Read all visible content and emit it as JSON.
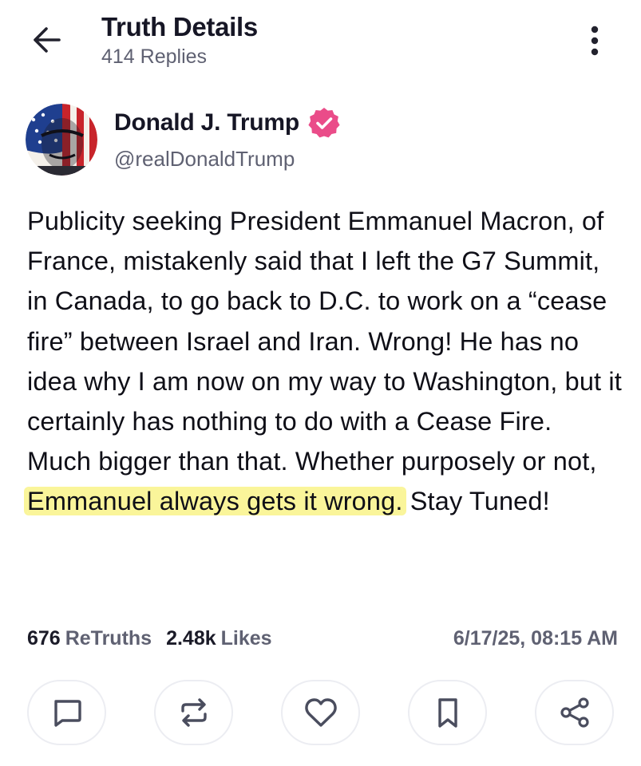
{
  "header": {
    "title": "Truth Details",
    "replies": "414 Replies",
    "back_icon": "arrow-left-icon",
    "more_icon": "more-vertical-icon"
  },
  "author": {
    "name": "Donald J. Trump",
    "handle": "@realDonaldTrump",
    "verified_icon": "verified-badge-icon",
    "verified_color": "#ea4c89"
  },
  "post": {
    "text_before": "Publicity seeking President Emmanuel Macron, of France, mistakenly said that I left the G7 Summit, in Canada, to go back to D.C. to work on a “cease fire” between Israel and Iran. Wrong! He has no idea why I am now on my way to Washington, but it certainly has nothing to do with a Cease Fire. Much bigger than that. Whether purposely or not, ",
    "text_highlighted": "Emmanuel always gets it wrong.",
    "text_after": " Stay Tuned!",
    "highlight_color": "#faf59a"
  },
  "stats": {
    "retruths_count": "676",
    "retruths_label": "ReTruths",
    "likes_count": "2.48k",
    "likes_label": "Likes",
    "timestamp": "6/17/25, 08:15 AM"
  },
  "actions": [
    {
      "name": "reply",
      "icon": "reply-icon"
    },
    {
      "name": "retruth",
      "icon": "retruth-icon"
    },
    {
      "name": "like",
      "icon": "heart-icon"
    },
    {
      "name": "bookmark",
      "icon": "bookmark-icon"
    },
    {
      "name": "share",
      "icon": "share-icon"
    }
  ],
  "colors": {
    "text_primary": "#161625",
    "text_secondary": "#5f6172",
    "icon": "#4a4d5e",
    "button_border": "#ecedf2"
  }
}
